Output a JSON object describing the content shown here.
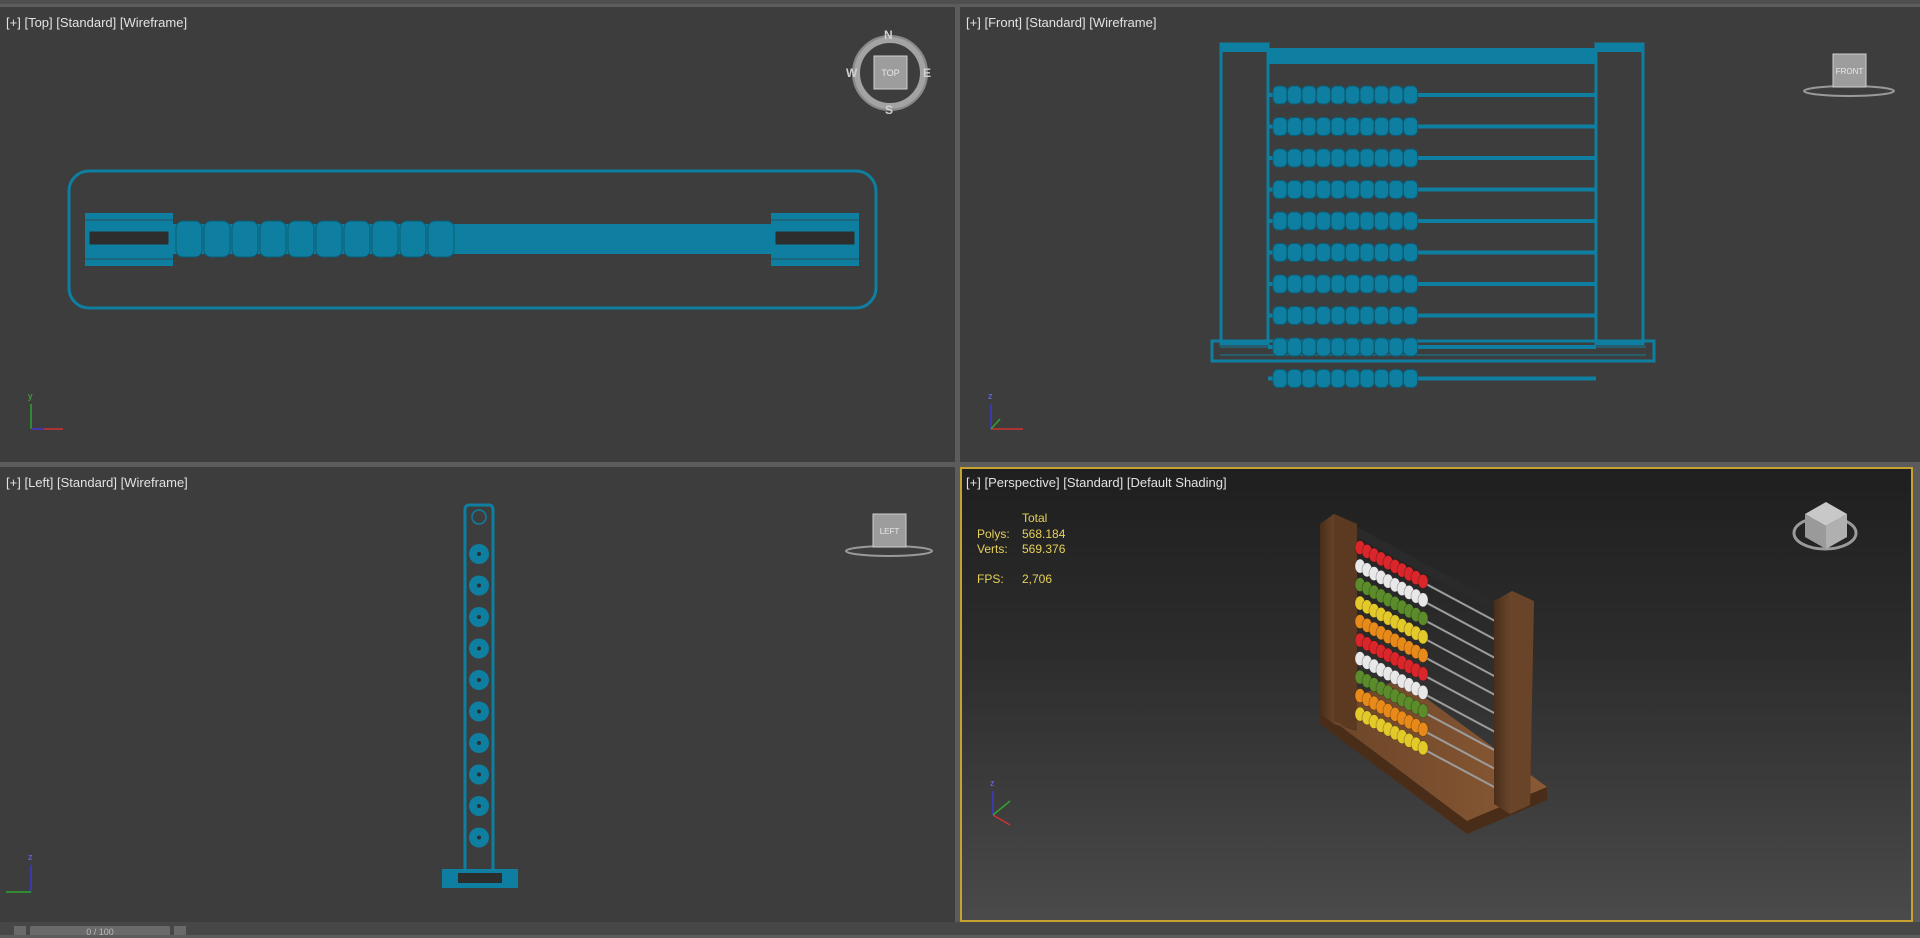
{
  "viewports": {
    "top": {
      "plus": "[+]",
      "view": "[Top]",
      "mode": "[Standard]",
      "shading": "[Wireframe]"
    },
    "front": {
      "plus": "[+]",
      "view": "[Front]",
      "mode": "[Standard]",
      "shading": "[Wireframe]"
    },
    "left": {
      "plus": "[+]",
      "view": "[Left]",
      "mode": "[Standard]",
      "shading": "[Wireframe]"
    },
    "perspective": {
      "plus": "[+]",
      "view": "[Perspective]",
      "mode": "[Standard]",
      "shading": "[Default Shading]"
    }
  },
  "compass": {
    "n": "N",
    "s": "S",
    "e": "E",
    "w": "W",
    "cube_label": "TOP"
  },
  "viewcube": {
    "front_label": "FRONT",
    "left_label": "LEFT"
  },
  "stats": {
    "total_label": "Total",
    "polys_label": "Polys:",
    "polys_value": "568.184",
    "verts_label": "Verts:",
    "verts_value": "569.376",
    "fps_label": "FPS:",
    "fps_value": "2,706"
  },
  "axis": {
    "x": "x",
    "y": "y",
    "z": "z"
  },
  "timeslider": {
    "frame": "0 / 100"
  },
  "colors": {
    "wireframe": "#0e7fa0",
    "viewport_bg": "#3d3d3d",
    "active_border": "#c6a230",
    "stats_text": "#e6d15a",
    "bead_rows": [
      "#d8262b",
      "#e8e8e8",
      "#5b8b2a",
      "#e3c92a",
      "#e78a1a",
      "#d8262b",
      "#e8e8e8",
      "#5b8b2a",
      "#e78a1a",
      "#e3c92a"
    ]
  }
}
